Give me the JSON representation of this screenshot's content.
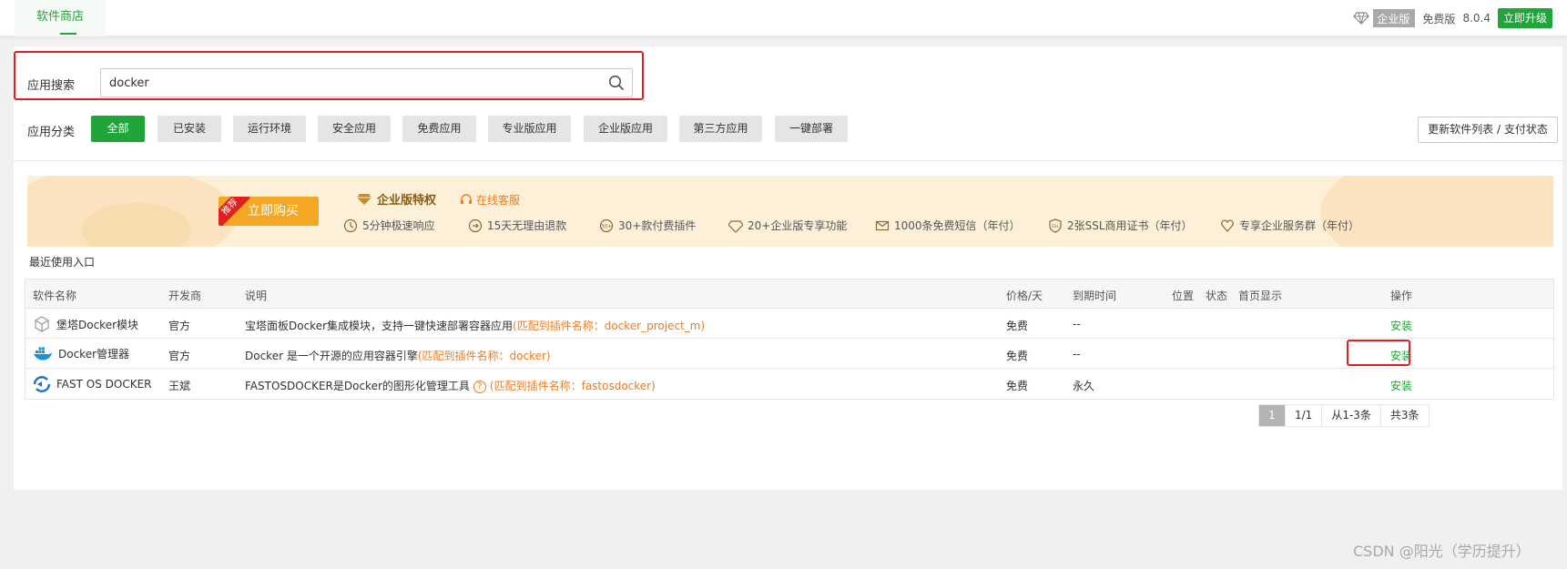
{
  "topbar": {
    "tab_label": "软件商店",
    "enterprise_label": "企业版",
    "free_label": "免费版",
    "version": "8.0.4",
    "upgrade_label": "立即升级"
  },
  "search": {
    "label": "应用搜索",
    "value": "docker"
  },
  "categories": {
    "label": "应用分类",
    "items": [
      "全部",
      "已安装",
      "运行环境",
      "安全应用",
      "免费应用",
      "专业版应用",
      "企业版应用",
      "第三方应用",
      "一键部署"
    ],
    "refresh_label": "更新软件列表 / 支付状态"
  },
  "promo": {
    "ribbon": "推荐",
    "buy_label": "立即购买",
    "title": "企业版特权",
    "customer_service": "在线客服",
    "features": [
      "5分钟极速响应",
      "15天无理由退款",
      "30+款付费插件",
      "20+企业版专享功能",
      "1000条免费短信（年付）",
      "2张SSL商用证书（年付）",
      "专享企业服务群（年付）"
    ]
  },
  "recent_label": "最近使用入口",
  "table": {
    "headers": {
      "name": "软件名称",
      "developer": "开发商",
      "desc": "说明",
      "price": "价格/天",
      "expire": "到期时间",
      "location": "位置",
      "status": "状态",
      "homepage": "首页显示",
      "action": "操作"
    },
    "rows": [
      {
        "name": "堡塔Docker模块",
        "developer": "官方",
        "desc": "宝塔面板Docker集成模块，支持一键快速部署容器应用",
        "match": "(匹配到插件名称：docker_project_m)",
        "price": "免费",
        "expire": "--",
        "action": "安装"
      },
      {
        "name": "Docker管理器",
        "developer": "官方",
        "desc": "Docker 是一个开源的应用容器引擎",
        "match": "(匹配到插件名称：docker)",
        "price": "免费",
        "expire": "--",
        "action": "安装"
      },
      {
        "name": "FAST OS DOCKER",
        "developer": "王斌",
        "desc": "FASTOSDOCKER是Docker的图形化管理工具",
        "qmark": "?",
        "match": "(匹配到插件名称：fastosdocker)",
        "price": "免费",
        "expire": "永久",
        "action": "安装"
      }
    ]
  },
  "pager": {
    "current": "1",
    "pages": "1/1",
    "range": "从1-3条",
    "total": "共3条"
  },
  "watermark": "CSDN @阳光（学历提升）",
  "colors": {
    "accent": "#20a53a",
    "highlight": "#e02020",
    "match": "#f07b1d"
  }
}
